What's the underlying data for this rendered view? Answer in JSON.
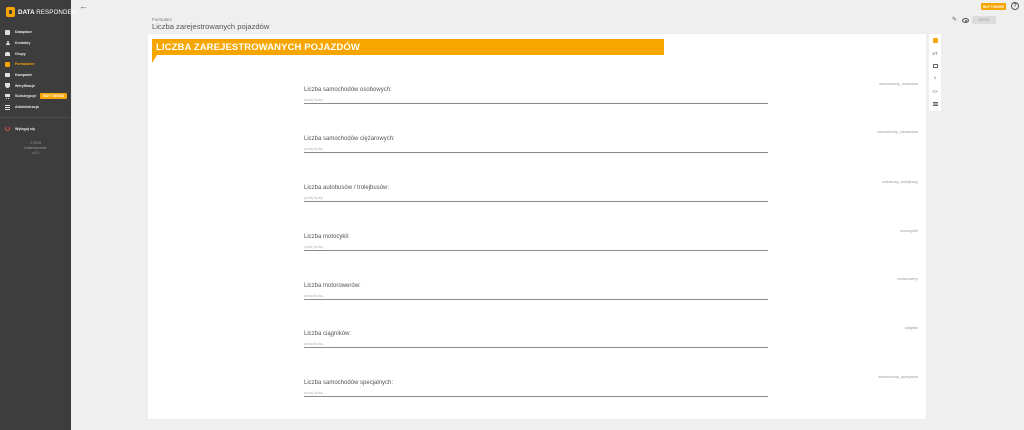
{
  "app": {
    "logo_bold": "DATA",
    "logo_thin": "RESPONDER",
    "brand_color": "#f7a600"
  },
  "sidebar": {
    "items": [
      {
        "label": "Dataplace",
        "icon": "dashboard-icon"
      },
      {
        "label": "Kontakty",
        "icon": "user-icon"
      },
      {
        "label": "Grupy",
        "icon": "group-icon"
      },
      {
        "label": "Formularze",
        "icon": "form-icon",
        "active": true
      },
      {
        "label": "Kampanie",
        "icon": "envelope-icon"
      },
      {
        "label": "Weryfikacje",
        "icon": "shield-icon"
      },
      {
        "label": "Subskrypcje",
        "icon": "cart-icon",
        "badge": "BUY TOKENS"
      },
      {
        "label": "Administracja",
        "icon": "list-icon"
      }
    ],
    "logout_label": "Wyloguj się",
    "footer": [
      "© 2019",
      "Dataresponder",
      "v.5.0"
    ]
  },
  "topbar": {
    "badge": "BUY TOKENS",
    "help": "?"
  },
  "header": {
    "breadcrumb": "Formularz",
    "title": "Liczba zarejestrowanych pojazdów",
    "save_label": "ZAPISZ"
  },
  "form": {
    "banner": "LICZBA ZAREJESTROWANYCH POJAZDÓW",
    "placeholder": "podaj liczbę",
    "fields": [
      {
        "label": "Liczba samochodów osobowych:",
        "key": "samochody_osobowe"
      },
      {
        "label": "Liczba samochodów ciężarowych:",
        "key": "samochody_ciezarowe"
      },
      {
        "label": "Liczba autobusów / trolejbusów:",
        "key": "autobusy_trolejbusy"
      },
      {
        "label": "Liczba motocykli:",
        "key": "motocykle"
      },
      {
        "label": "Liczba motorowerów:",
        "key": "motorowery"
      },
      {
        "label": "Liczba ciągników:",
        "key": "ciagniki"
      },
      {
        "label": "Liczba samochodów specjalnych:",
        "key": "samochody_specjalne"
      }
    ]
  },
  "side_tools": {
    "text_tool": "aT",
    "code_tool": "<>"
  }
}
